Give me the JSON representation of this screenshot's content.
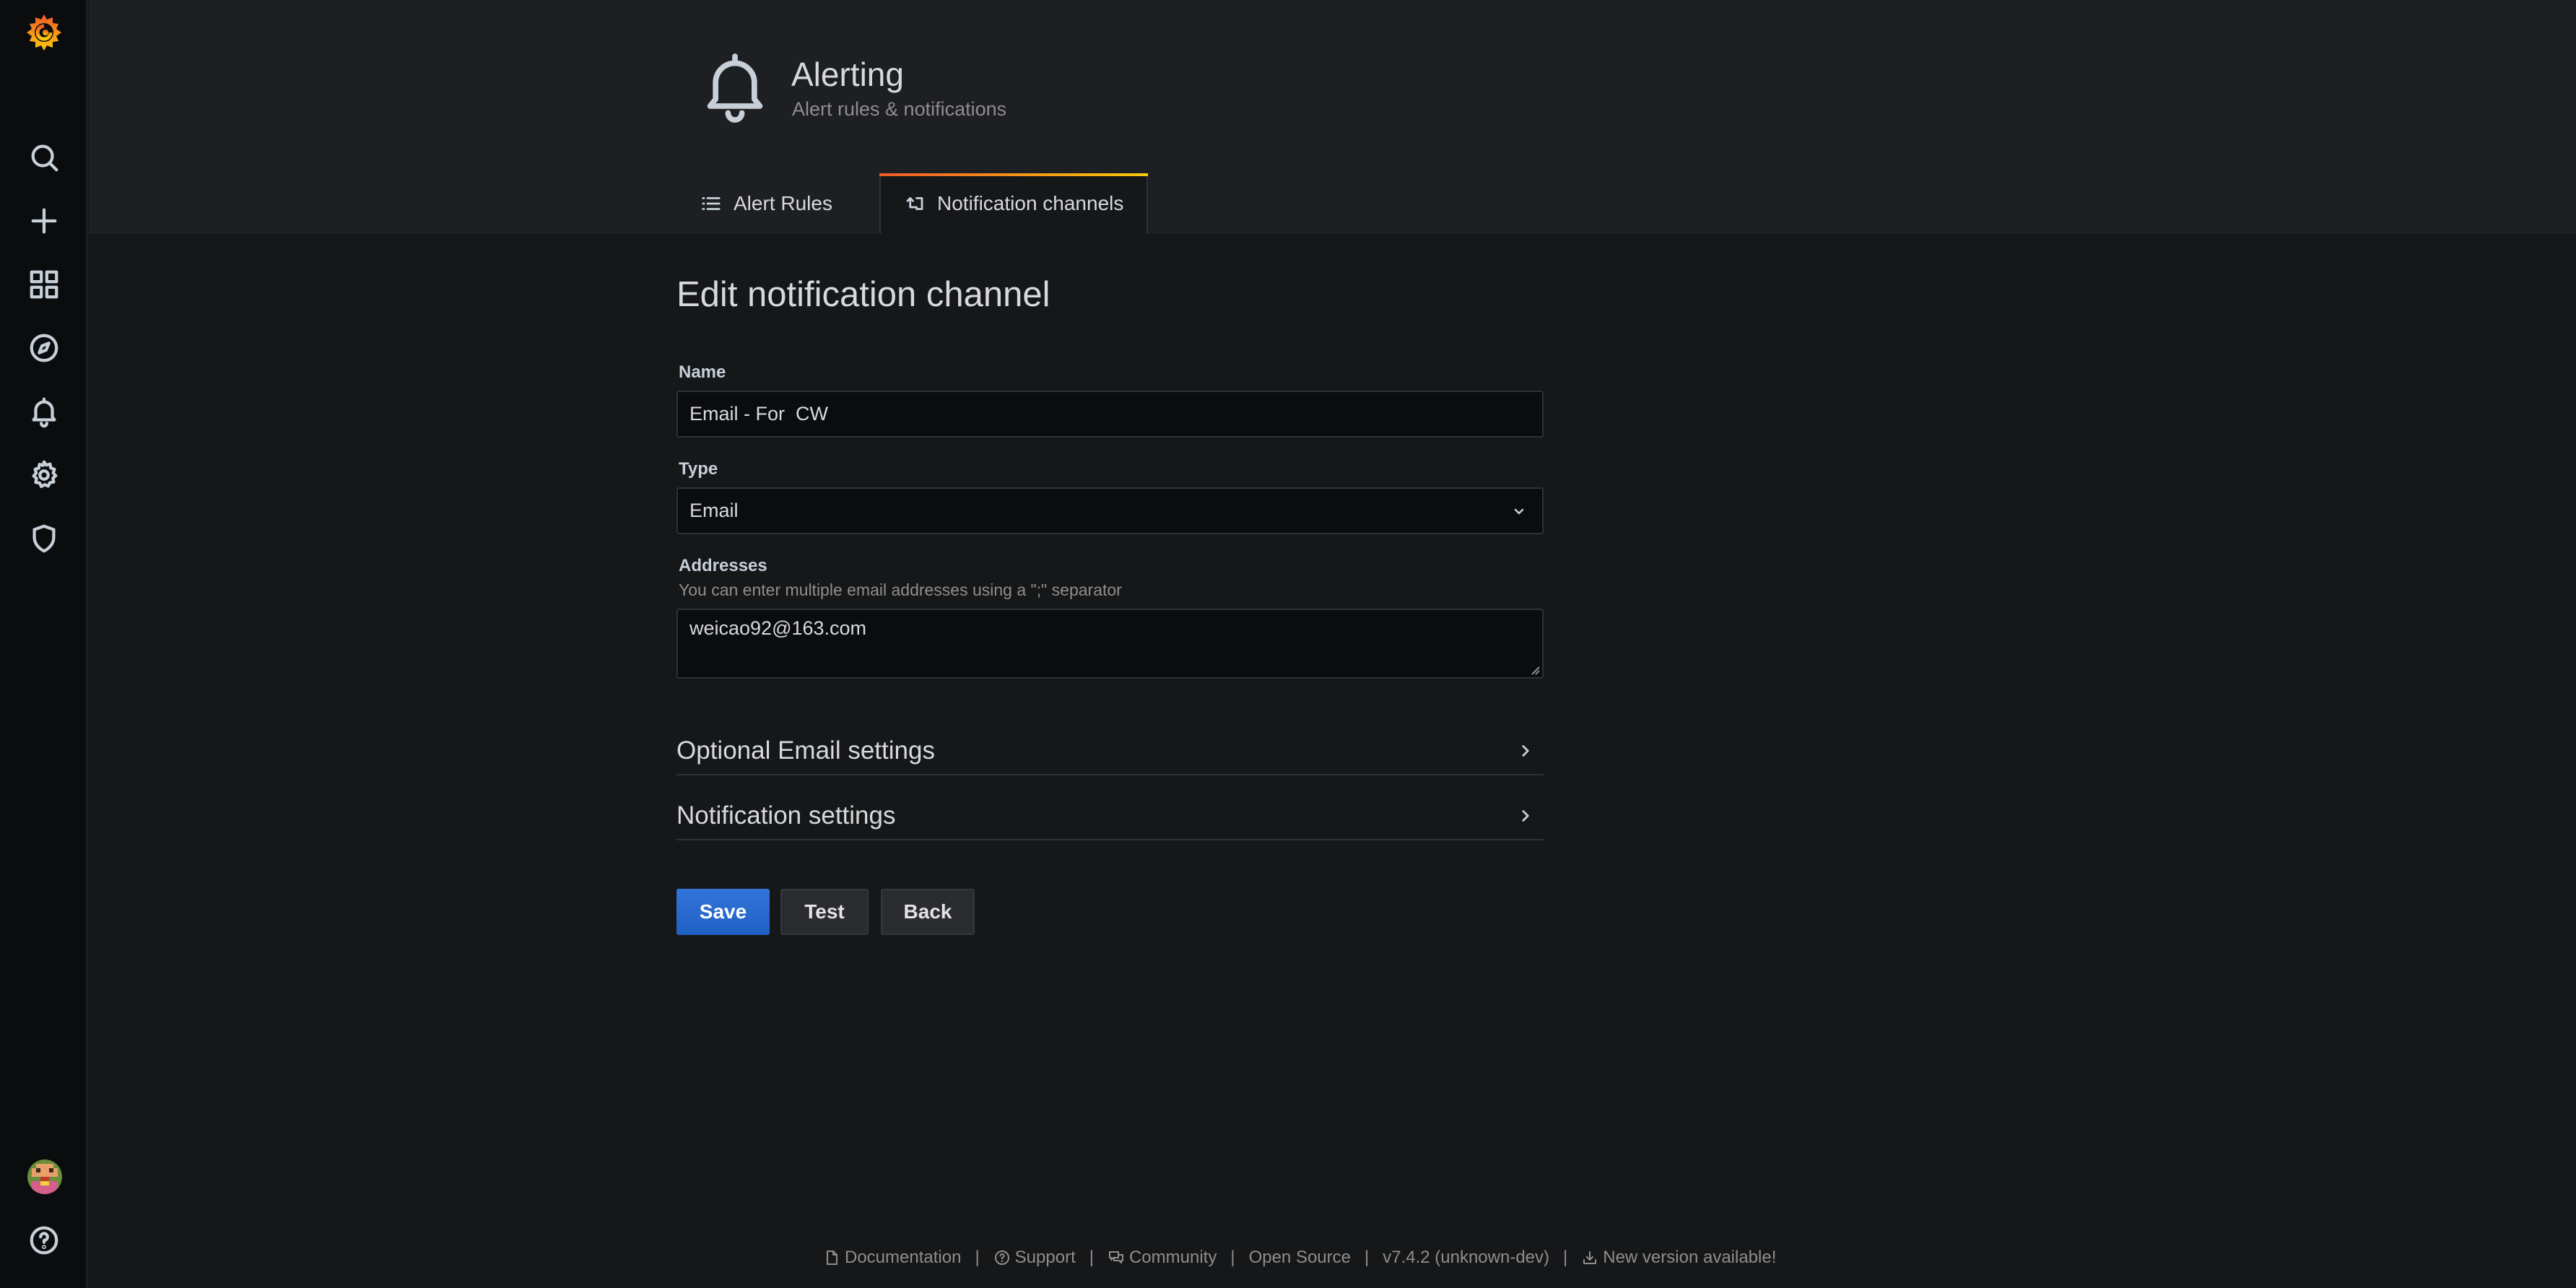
{
  "colors": {
    "accent": "#3274d9",
    "tab_gradient_start": "#f05a28",
    "tab_gradient_end": "#fbca0a",
    "background": "#161719",
    "header_background": "#1e1f22",
    "sidebar_background": "#0b0c0e"
  },
  "sidebar": {
    "logo_icon": "grafana-logo-icon",
    "items": [
      {
        "icon": "search-icon"
      },
      {
        "icon": "plus-icon"
      },
      {
        "icon": "dashboards-icon"
      },
      {
        "icon": "explore-compass-icon"
      },
      {
        "icon": "alerting-bell-icon"
      },
      {
        "icon": "configuration-gear-icon"
      },
      {
        "icon": "server-admin-shield-icon"
      }
    ],
    "bottom": [
      {
        "icon": "user-avatar"
      },
      {
        "icon": "help-icon"
      }
    ]
  },
  "header": {
    "icon": "bell-icon",
    "title": "Alerting",
    "subtitle": "Alert rules & notifications",
    "tabs": [
      {
        "label": "Alert Rules",
        "icon": "list-icon",
        "active": false
      },
      {
        "label": "Notification channels",
        "icon": "notification-channels-icon",
        "active": true
      }
    ]
  },
  "form": {
    "title": "Edit notification channel",
    "name_label": "Name",
    "name_value": "Email - For  CW",
    "type_label": "Type",
    "type_value": "Email",
    "addresses_label": "Addresses",
    "addresses_description": "You can enter multiple email addresses using a \";\" separator",
    "addresses_value": "weicao92@163.com",
    "sections": [
      {
        "label": "Optional Email settings"
      },
      {
        "label": "Notification settings"
      }
    ],
    "buttons": {
      "save": "Save",
      "test": "Test",
      "back": "Back"
    }
  },
  "footer": {
    "documentation": "Documentation",
    "support": "Support",
    "community": "Community",
    "open_source": "Open Source",
    "version": "v7.4.2 (unknown-dev)",
    "new_version": "New version available!",
    "separator": "|"
  }
}
